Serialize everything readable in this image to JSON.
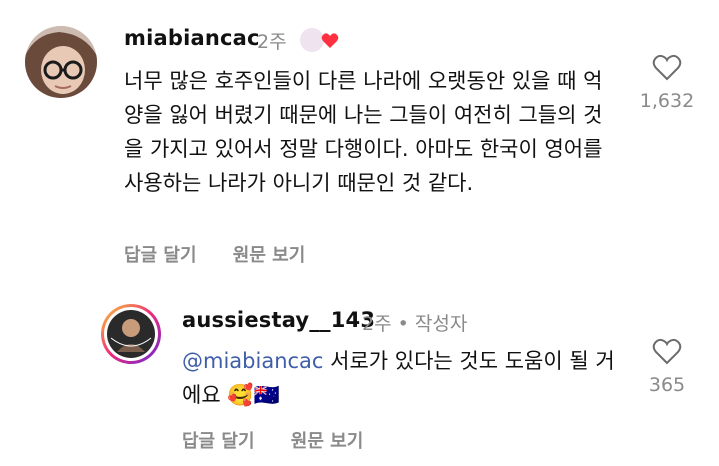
{
  "comment": {
    "username": "miabiancac",
    "time": "2주",
    "text": "너무 많은 호주인들이 다른 나라에 오랫동안 있을 때 억양을 잃어 버렸기 때문에 나는 그들이 여전히 그들의 것을 가지고 있어서 정말 다행이다. 아마도 한국이 영어를 사용하는 나라가 아니기 때문인 것 같다.",
    "like_count": "1,632",
    "reply_label": "답글 달기",
    "original_label": "원문 보기",
    "author_liked_icon": "heart-icon"
  },
  "reply": {
    "username": "aussiestay__143",
    "time": "2주",
    "author_badge": "작성자",
    "mention": "@miabiancac",
    "text": "서로가 있다는 것도 도움이 될 거에요 🥰🇦🇺",
    "like_count": "365",
    "reply_label": "답글 달기",
    "original_label": "원문 보기",
    "avatar_text": "AUSSIE STAY"
  },
  "colors": {
    "heart": "#ff3040",
    "mention": "#3f5ea8",
    "muted": "#8a8a8a"
  }
}
